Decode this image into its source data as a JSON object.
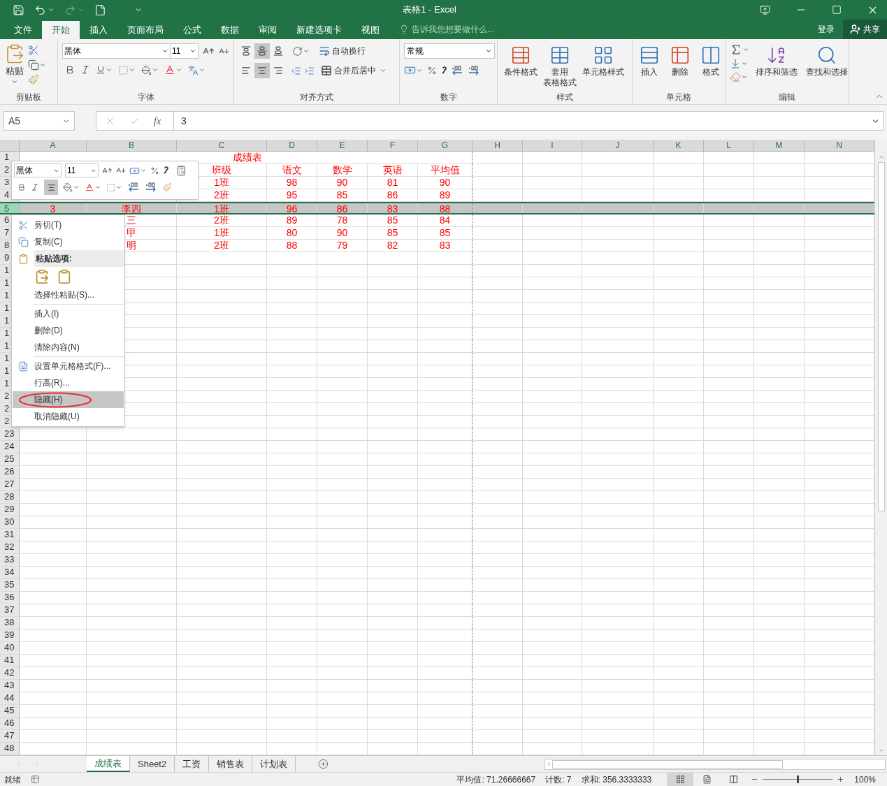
{
  "window": {
    "title": "表格1 - Excel"
  },
  "tabs": [
    {
      "label": "文件",
      "selected": false
    },
    {
      "label": "开始",
      "selected": true
    },
    {
      "label": "插入",
      "selected": false
    },
    {
      "label": "页面布局",
      "selected": false
    },
    {
      "label": "公式",
      "selected": false
    },
    {
      "label": "数据",
      "selected": false
    },
    {
      "label": "审阅",
      "selected": false
    },
    {
      "label": "新建选项卡",
      "selected": false
    },
    {
      "label": "视图",
      "selected": false
    }
  ],
  "tell_me": {
    "placeholder": "告诉我您想要做什么..."
  },
  "account": {
    "login": "登录",
    "share": "共享"
  },
  "ribbon": {
    "clipboard": {
      "label": "剪贴板",
      "paste": "粘贴"
    },
    "font": {
      "label": "字体",
      "font_name": "黑体",
      "font_size": "11"
    },
    "alignment": {
      "label": "对齐方式",
      "wrap": "自动换行",
      "merge": "合并后居中",
      "vertical": [
        {
          "kind": "top",
          "selected": false
        },
        {
          "kind": "middle",
          "selected": true
        },
        {
          "kind": "bottom",
          "selected": false
        }
      ],
      "horizontal": [
        {
          "kind": "left",
          "selected": false
        },
        {
          "kind": "center",
          "selected": true
        },
        {
          "kind": "right",
          "selected": false
        }
      ]
    },
    "number": {
      "label": "数字",
      "format": "常规"
    },
    "styles": {
      "label": "样式",
      "buttons": [
        {
          "kind": "conditional",
          "label": "条件格式"
        },
        {
          "kind": "table",
          "label": "套用",
          "second_line": "表格格式"
        },
        {
          "kind": "cell",
          "label": "单元格样式"
        }
      ]
    },
    "cells": {
      "label": "单元格",
      "buttons": [
        {
          "kind": "insert",
          "label": "插入"
        },
        {
          "kind": "delete",
          "label": "删除"
        },
        {
          "kind": "format",
          "label": "格式"
        }
      ]
    },
    "editing": {
      "label": "编辑",
      "buttons": [
        {
          "kind": "sort",
          "label": "排序和筛选"
        },
        {
          "kind": "find",
          "label": "查找和选择"
        }
      ]
    }
  },
  "formula_bar": {
    "name_box": "A5",
    "fx": "fx",
    "value": "3"
  },
  "columns": [
    "A",
    "B",
    "C",
    "D",
    "E",
    "F",
    "G",
    "H",
    "I",
    "J",
    "K",
    "L",
    "M",
    "N"
  ],
  "rows": [
    {
      "header": "1",
      "selected": false,
      "title": "成绩表"
    },
    {
      "header": "2",
      "selected": false,
      "cells": [
        null,
        null,
        "班级",
        "语文",
        "数学",
        "英语",
        "平均值"
      ]
    },
    {
      "header": "3",
      "selected": false,
      "cells": [
        null,
        null,
        "1班",
        "98",
        "90",
        "81",
        "90"
      ]
    },
    {
      "header": "4",
      "selected": false,
      "cells": [
        null,
        null,
        "2班",
        "95",
        "85",
        "86",
        "89"
      ]
    },
    {
      "header": "5",
      "selected": true,
      "cells": [
        "3",
        "李四",
        "1班",
        "96",
        "86",
        "83",
        "88"
      ]
    },
    {
      "header": "6",
      "selected": false,
      "cells": [
        null,
        "三",
        "2班",
        "89",
        "78",
        "85",
        "84"
      ]
    },
    {
      "header": "7",
      "selected": false,
      "cells": [
        null,
        "甲",
        "1班",
        "80",
        "90",
        "85",
        "85"
      ]
    },
    {
      "header": "8",
      "selected": false,
      "cells": [
        null,
        "明",
        "2班",
        "88",
        "79",
        "82",
        "83"
      ]
    },
    {
      "header": "9",
      "selected": false
    },
    {
      "header": "1",
      "selected": false
    },
    {
      "header": "1",
      "selected": false
    },
    {
      "header": "1",
      "selected": false
    },
    {
      "header": "1",
      "selected": false
    },
    {
      "header": "1",
      "selected": false
    },
    {
      "header": "1",
      "selected": false
    },
    {
      "header": "1",
      "selected": false
    },
    {
      "header": "1",
      "selected": false
    },
    {
      "header": "1",
      "selected": false
    },
    {
      "header": "1",
      "selected": false
    },
    {
      "header": "2",
      "selected": false
    },
    {
      "header": "2",
      "selected": false
    },
    {
      "header": "2",
      "selected": false
    },
    {
      "header": "23",
      "selected": false
    },
    {
      "header": "24",
      "selected": false
    },
    {
      "header": "25",
      "selected": false
    },
    {
      "header": "26",
      "selected": false
    },
    {
      "header": "27",
      "selected": false
    },
    {
      "header": "28",
      "selected": false
    },
    {
      "header": "29",
      "selected": false
    },
    {
      "header": "30",
      "selected": false
    },
    {
      "header": "31",
      "selected": false
    },
    {
      "header": "32",
      "selected": false
    },
    {
      "header": "33",
      "selected": false
    },
    {
      "header": "34",
      "selected": false
    },
    {
      "header": "35",
      "selected": false
    },
    {
      "header": "36",
      "selected": false
    },
    {
      "header": "37",
      "selected": false
    },
    {
      "header": "38",
      "selected": false
    },
    {
      "header": "39",
      "selected": false
    },
    {
      "header": "40",
      "selected": false
    },
    {
      "header": "41",
      "selected": false
    },
    {
      "header": "42",
      "selected": false
    },
    {
      "header": "43",
      "selected": false
    },
    {
      "header": "44",
      "selected": false
    },
    {
      "header": "45",
      "selected": false
    },
    {
      "header": "46",
      "selected": false
    },
    {
      "header": "47",
      "selected": false
    },
    {
      "header": "48",
      "selected": false
    }
  ],
  "mini_toolbar": {
    "font_name": "黑体",
    "font_size": "11",
    "center_selected": true
  },
  "context_menu": [
    {
      "kind": "cut",
      "label": "剪切(T)",
      "selected": false
    },
    {
      "kind": "copy",
      "label": "复制(C)",
      "selected": false
    },
    {
      "kind": "header",
      "label": "粘贴选项:"
    },
    {
      "kind": "paste_icons"
    },
    {
      "kind": "command",
      "label": "选择性粘贴(S)...",
      "selected": false
    },
    {
      "kind": "divider"
    },
    {
      "kind": "command",
      "label": "插入(I)",
      "selected": false
    },
    {
      "kind": "command",
      "label": "删除(D)",
      "selected": false
    },
    {
      "kind": "command",
      "label": "清除内容(N)",
      "selected": false
    },
    {
      "kind": "divider"
    },
    {
      "kind": "format",
      "label": "设置单元格格式(F)...",
      "selected": false
    },
    {
      "kind": "command",
      "label": "行高(R)...",
      "selected": false
    },
    {
      "kind": "command",
      "label": "隐藏(H)",
      "selected": true
    },
    {
      "kind": "command",
      "label": "取消隐藏(U)",
      "selected": false
    }
  ],
  "sheets": [
    {
      "label": "成绩表",
      "selected": true
    },
    {
      "label": "Sheet2",
      "selected": false
    },
    {
      "label": "工资",
      "selected": false
    },
    {
      "label": "销售表",
      "selected": false
    },
    {
      "label": "计划表",
      "selected": false
    }
  ],
  "status_bar": {
    "ready": "就绪",
    "stats": [
      "平均值: 71.26666667",
      "计数: 7",
      "求和: 356.3333333"
    ],
    "views": [
      {
        "kind": "normal",
        "selected": true
      },
      {
        "kind": "layout",
        "selected": false
      },
      {
        "kind": "break",
        "selected": false
      }
    ],
    "zoom": {
      "level": 0.5,
      "reading": "100%"
    }
  }
}
